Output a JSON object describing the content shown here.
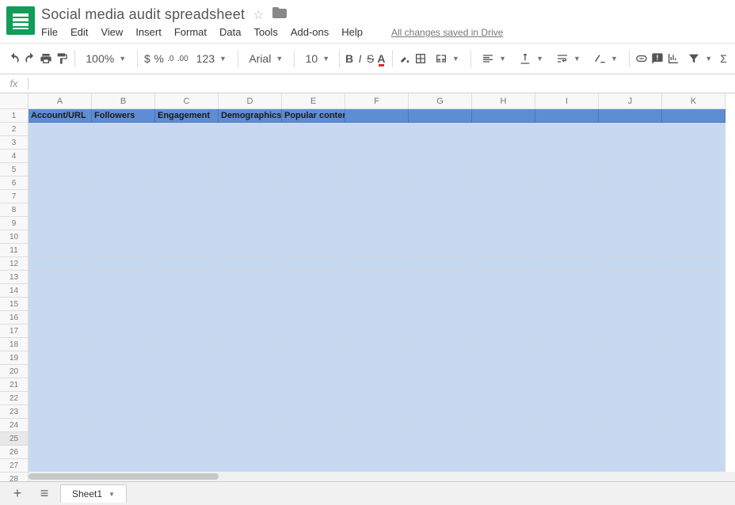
{
  "doc": {
    "title": "Social media audit spreadsheet",
    "save_status": "All changes saved in Drive"
  },
  "menubar": {
    "file": "File",
    "edit": "Edit",
    "view": "View",
    "insert": "Insert",
    "format": "Format",
    "data": "Data",
    "tools": "Tools",
    "addons": "Add-ons",
    "help": "Help"
  },
  "toolbar": {
    "zoom": "100%",
    "currency": "$",
    "percent": "%",
    "dec_dec": ".0",
    "dec_inc": ".00",
    "format_123": "123",
    "font": "Arial",
    "font_size": "10"
  },
  "fx_label": "fx",
  "columns": [
    "A",
    "B",
    "C",
    "D",
    "E",
    "F",
    "G",
    "H",
    "I",
    "J",
    "K"
  ],
  "row_count": 28,
  "header_row": [
    "Account/URL",
    "Followers",
    "Engagement",
    "Demographics",
    "Popular content",
    "",
    "",
    "",
    "",
    "",
    ""
  ],
  "sheet_tab": "Sheet1",
  "active_row": 25
}
